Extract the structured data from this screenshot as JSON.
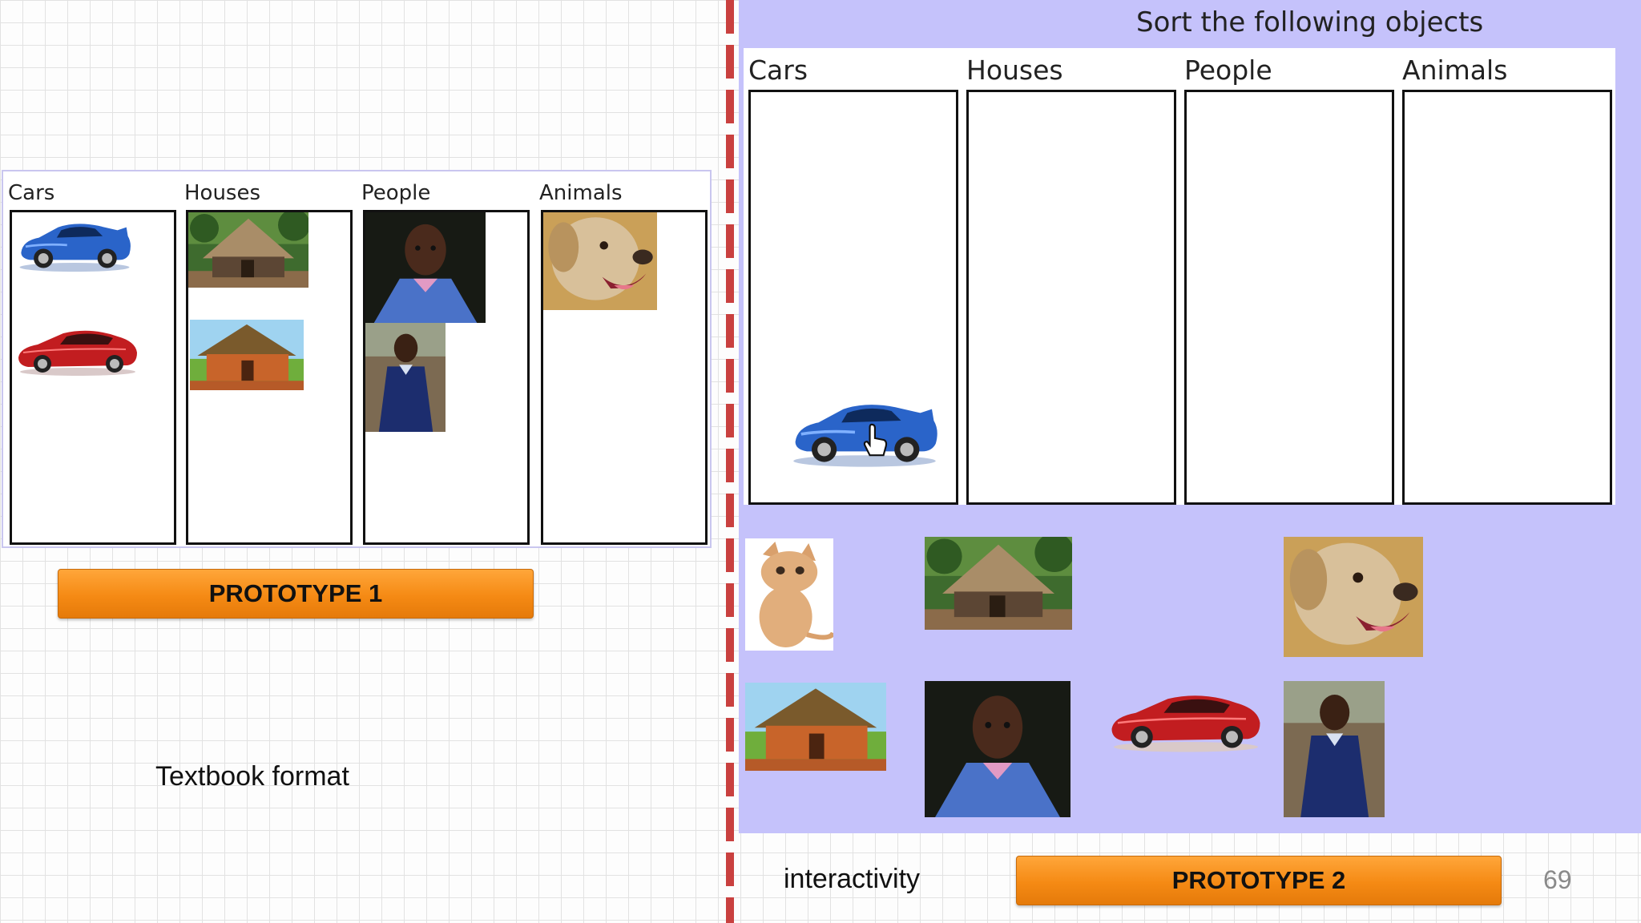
{
  "prototype1": {
    "columns": [
      "Cars",
      "Houses",
      "People",
      "Animals"
    ],
    "button_label": "PROTOTYPE 1",
    "caption": "Textbook format"
  },
  "prototype2": {
    "title": "Sort the following objects",
    "columns": [
      "Cars",
      "Houses",
      "People",
      "Animals"
    ],
    "caption": "interactivity",
    "button_label": "PROTOTYPE 2"
  },
  "page_number": "69",
  "icons": {
    "blue_car": "blue-car-image",
    "red_car": "red-car-image",
    "hut": "grass-hut-image",
    "round_house": "round-house-image",
    "girl": "girl-photo",
    "boy": "boy-photo",
    "dog": "dog-photo",
    "kitten": "kitten-photo",
    "cursor": "hand-cursor-icon"
  },
  "colors": {
    "panel_bg": "#c5c2fb",
    "button_orange": "#f58a14",
    "divider_red": "#c9403f"
  }
}
